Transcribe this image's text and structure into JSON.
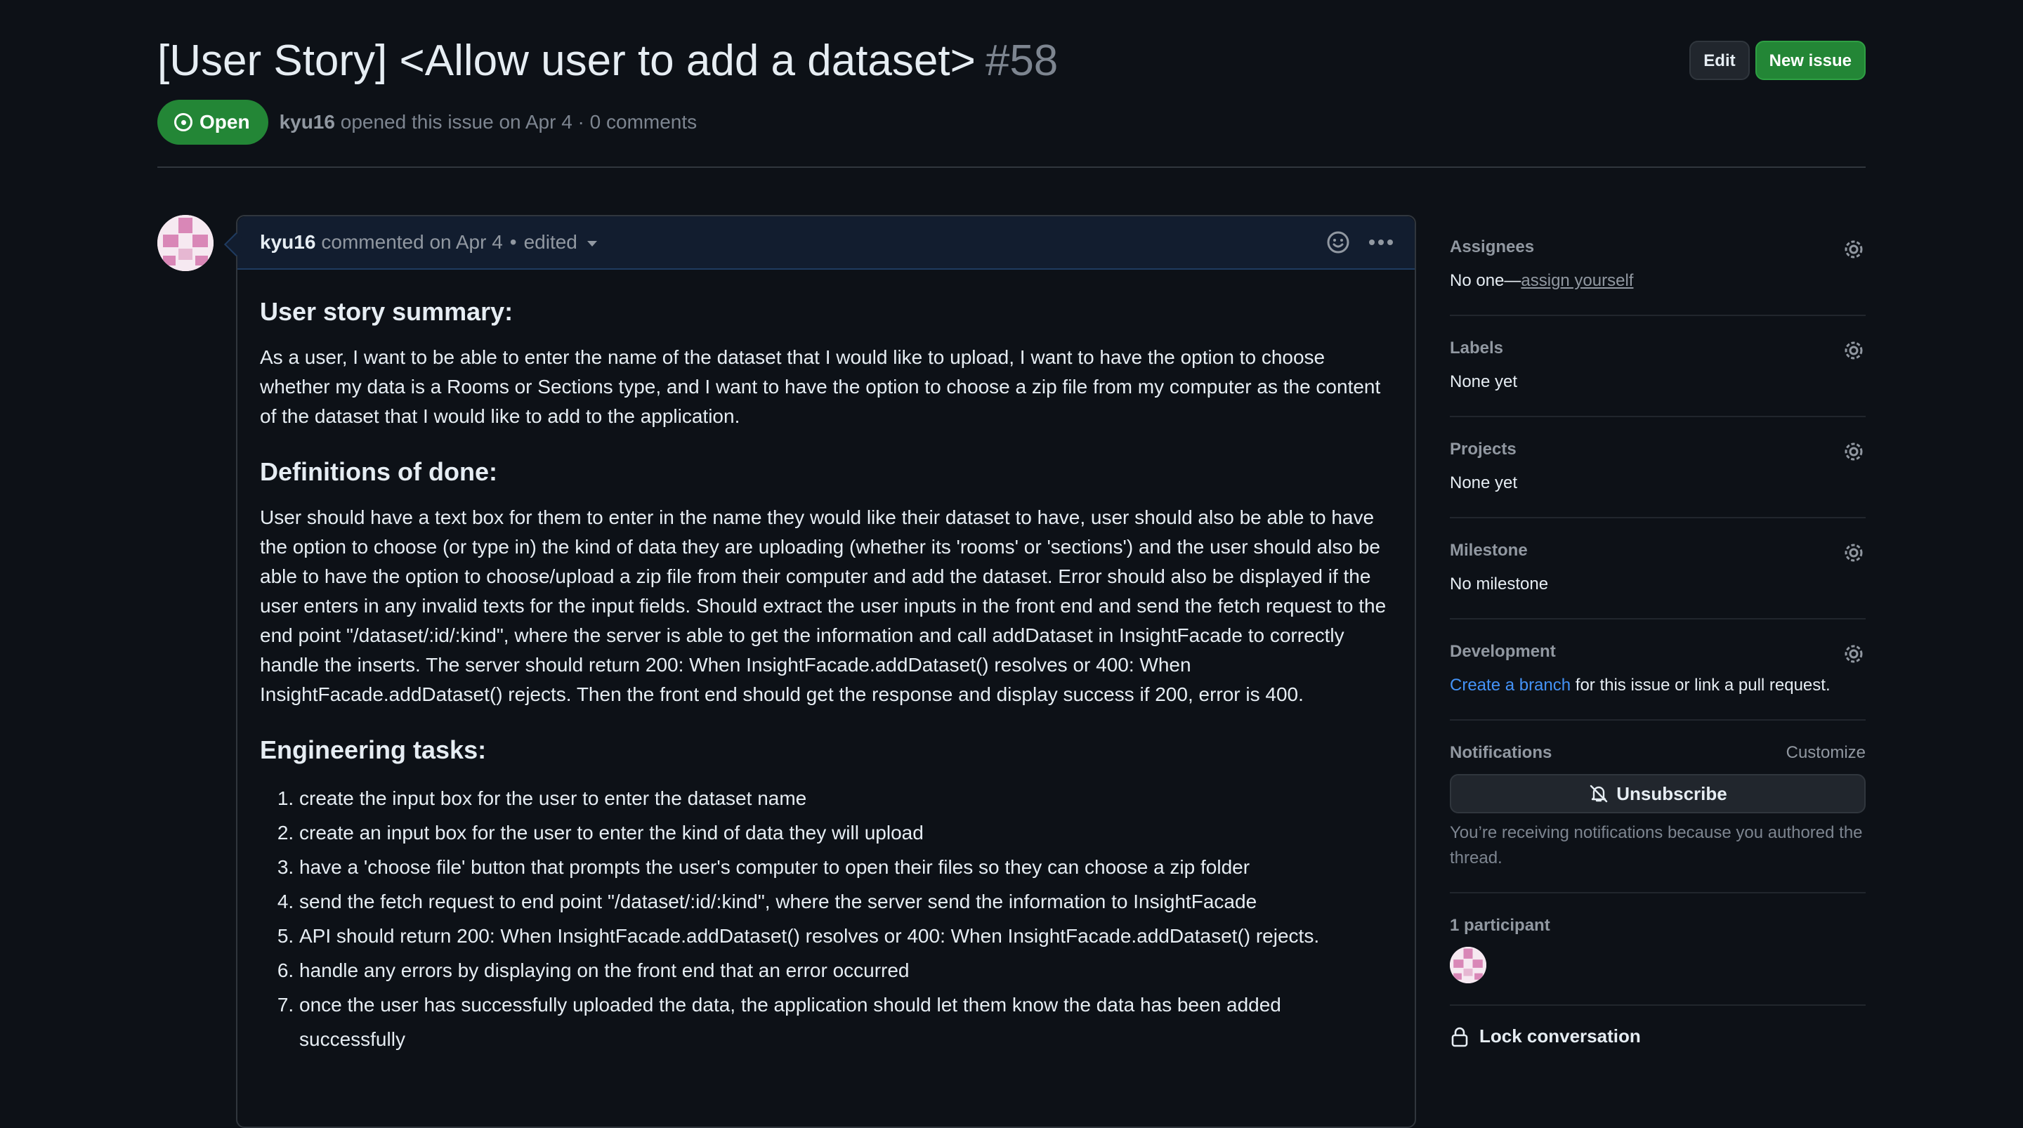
{
  "issue": {
    "title": "[User Story] <Allow user to add a dataset>",
    "number": "#58",
    "state": "Open",
    "author": "kyu16",
    "meta_text": "opened this issue on Apr 4 · 0 comments"
  },
  "actions": {
    "edit_label": "Edit",
    "new_issue_label": "New issue"
  },
  "comment": {
    "author": "kyu16",
    "meta": "commented on Apr 4",
    "bullet": "•",
    "edited": "edited",
    "summary_heading": "User story summary:",
    "summary_text": "As a user, I want to be able to enter the name of the dataset that I would like to upload, I want to have the option to choose whether my data is a Rooms or Sections type, and I want to have the option to choose a zip file from my computer as the content of the dataset that I would like to add to the application.",
    "dod_heading": "Definitions of done:",
    "dod_text": "User should have a text box for them to enter in the name they would like their dataset to have, user should also be able to have the option to choose (or type in) the kind of data they are uploading (whether its 'rooms' or 'sections') and the user should also be able to have the option to choose/upload a zip file from their computer and add the dataset. Error should also be displayed if the user enters in any invalid texts for the input fields. Should extract the user inputs in the front end and send the fetch request to the end point \"/dataset/:id/:kind\", where the server is able to get the information and call addDataset in InsightFacade to correctly handle the inserts. The server should return 200: When InsightFacade.addDataset() resolves or 400: When InsightFacade.addDataset() rejects. Then the front end should get the response and display success if 200, error is 400.",
    "tasks_heading": "Engineering tasks:",
    "tasks": [
      "create the input box for the user to enter the dataset name",
      "create an input box for the user to enter the kind of data they will upload",
      "have a 'choose file' button that prompts the user's computer to open their files so they can choose a zip folder",
      "send the fetch request to end point \"/dataset/:id/:kind\", where the server send the information to InsightFacade",
      "API should return 200: When InsightFacade.addDataset() resolves or 400: When InsightFacade.addDataset() rejects.",
      "handle any errors by displaying on the front end that an error occurred",
      "once the user has successfully uploaded the data, the application should let them know the data has been added successfully"
    ]
  },
  "sidebar": {
    "assignees": {
      "title": "Assignees",
      "prefix": "No one—",
      "link": "assign yourself"
    },
    "labels": {
      "title": "Labels",
      "value": "None yet"
    },
    "projects": {
      "title": "Projects",
      "value": "None yet"
    },
    "milestone": {
      "title": "Milestone",
      "value": "No milestone"
    },
    "development": {
      "title": "Development",
      "link": "Create a branch",
      "suffix": " for this issue or link a pull request."
    },
    "notifications": {
      "title": "Notifications",
      "customize": "Customize",
      "unsubscribe": "Unsubscribe",
      "note": "You’re receiving notifications because you authored the thread."
    },
    "participants": {
      "title": "1 participant"
    },
    "lock": {
      "label": "Lock conversation"
    }
  },
  "colors": {
    "open": "#238636",
    "link": "#4493f8",
    "background": "#0d1117"
  }
}
